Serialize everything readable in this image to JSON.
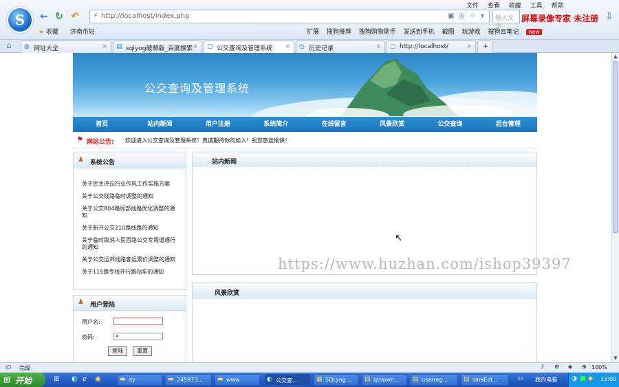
{
  "browser": {
    "menu": [
      "文件",
      "查看",
      "收藏",
      "工具",
      "帮助"
    ],
    "url": "http://localhost/index.php",
    "search_placeholder": "输入文字",
    "recorder_text": "屏幕录像专家  未注册",
    "bookmarks": [
      "收藏",
      "济南市妇"
    ],
    "extensions": [
      "扩展",
      "搜狗推荐",
      "搜狗购物助手",
      "发送到手机",
      "截图",
      "玩游戏",
      "搜狗云笔记",
      "new"
    ],
    "tabs": [
      {
        "label": "网址大全"
      },
      {
        "label": "sqlyog破解版_百度搜索"
      },
      {
        "label": "公交查询及管理系统"
      },
      {
        "label": "历史记录"
      },
      {
        "label": "http://localhost/"
      }
    ],
    "status": {
      "left": "完成",
      "right": "100%"
    }
  },
  "site": {
    "title": "公交查询及管理系统",
    "nav": [
      "首页",
      "站内新闻",
      "用户注册",
      "系统简介",
      "在线留言",
      "风景欣赏",
      "公交查询",
      "后台管理"
    ],
    "notice": {
      "label": "网站公告:",
      "text": "欢迎进入公交查询及管理系统！真诚期待你的加入！祝您旅途愉快！"
    },
    "sys_notice": {
      "title": "系统公告",
      "items": [
        "关于民主评议行业作风工作实施方案",
        "关于公交线路临时调整的通知",
        "关于公交804路局部线路优化调整的通知",
        "关于新开公交210路线路的通知",
        "关于临时取消人民西路公交专用道通行的通知",
        "关于公交运郊线路客运票价调整的通知",
        "关于115路专线开行路站车的通知"
      ]
    },
    "login": {
      "title": "用户登陆",
      "username_label": "用户名:",
      "password_label": "密码:",
      "password_value": "•",
      "submit": "登陆",
      "reset": "重置"
    },
    "news": {
      "title": "站内新闻"
    },
    "scenery": {
      "title": "风景欣赏"
    }
  },
  "watermark": "https://www.huzhan.com/ishop39397",
  "taskbar": {
    "start": "开始",
    "tasks": [
      "dy",
      "245973...",
      "www",
      "公交查...",
      "SQLyog ...",
      "qtdown...",
      "userreg...",
      "sinaEdi..."
    ],
    "tray_label": "我的电脑",
    "clock": "13:00"
  }
}
